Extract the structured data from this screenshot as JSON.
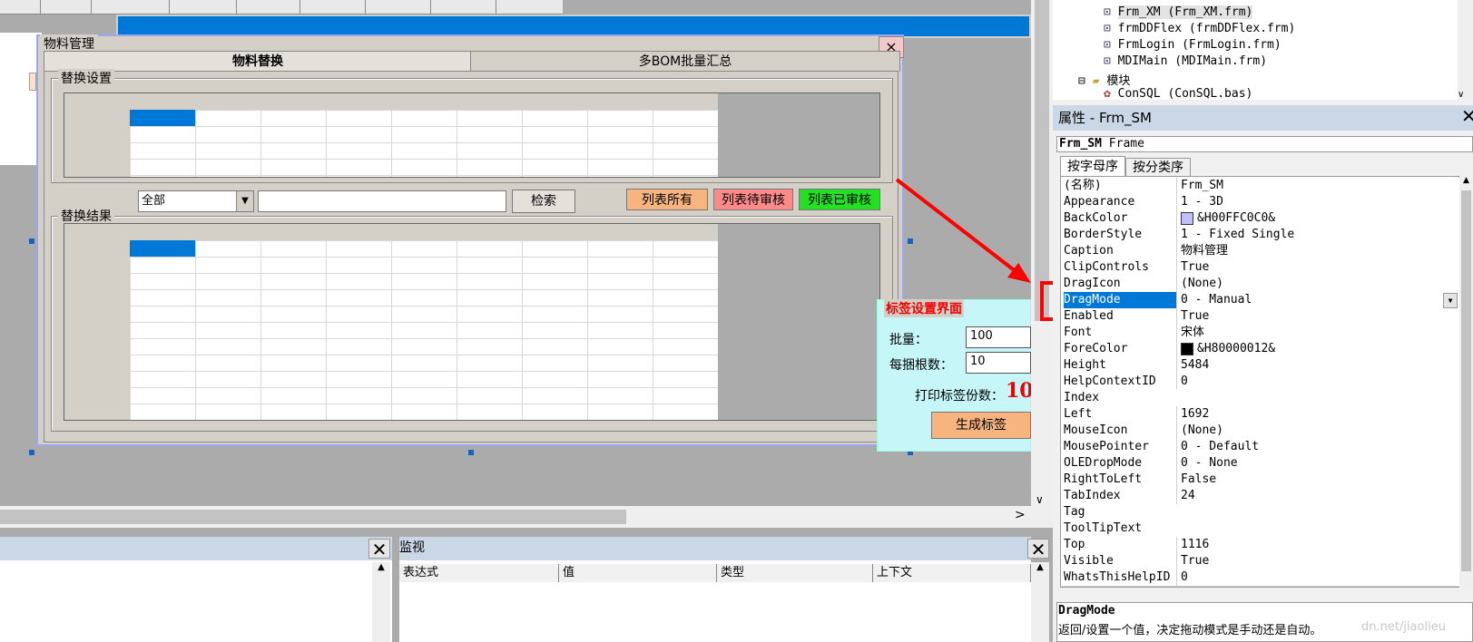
{
  "form": {
    "caption": "物料管理",
    "close": "×",
    "tabs": [
      {
        "label": "物料替换"
      },
      {
        "label": "多BOM批量汇总"
      }
    ],
    "frame_settings": "替换设置",
    "frame_results": "替换结果",
    "filter_value": "全部",
    "search_label": "检索",
    "btn_all": "列表所有",
    "btn_pending": "列表待审核",
    "btn_approved": "列表已审核"
  },
  "label_dialog": {
    "title": "标签设置界面",
    "qty_label": "批量：",
    "qty_value": "100",
    "per_bundle_label": "每捆根数：",
    "per_bundle_value": "10",
    "copies_label": "打印标签份数：",
    "copies_value": "10",
    "generate_label": "生成标签"
  },
  "watch": {
    "title": "监视",
    "columns": [
      "表达式",
      "值",
      "类型",
      "上下文"
    ]
  },
  "project_tree": {
    "items": [
      {
        "text": "Frm_XM (Frm_XM.frm)"
      },
      {
        "text": "frmDDFlex (frmDDFlex.frm)"
      },
      {
        "text": "FrmLogin (FrmLogin.frm)"
      },
      {
        "text": "MDIMain (MDIMain.frm)"
      }
    ],
    "folder_modules": "模块",
    "module_item": "ConSQL (ConSQL.bas)"
  },
  "properties": {
    "title": "属性 - Frm_SM",
    "object_name": "Frm_SM",
    "object_type": "Frame",
    "tab_alpha": "按字母序",
    "tab_category": "按分类序",
    "rows": [
      {
        "name": "(名称)",
        "value": "Frm_SM"
      },
      {
        "name": "Appearance",
        "value": "1 - 3D"
      },
      {
        "name": "BackColor",
        "value": "&H00FFC0C0&"
      },
      {
        "name": "BorderStyle",
        "value": "1 - Fixed Single"
      },
      {
        "name": "Caption",
        "value": "物料管理"
      },
      {
        "name": "ClipControls",
        "value": "True"
      },
      {
        "name": "DragIcon",
        "value": "(None)"
      },
      {
        "name": "DragMode",
        "value": "0 - Manual"
      },
      {
        "name": "Enabled",
        "value": "True"
      },
      {
        "name": "Font",
        "value": "宋体"
      },
      {
        "name": "ForeColor",
        "value": "&H80000012&"
      },
      {
        "name": "Height",
        "value": "5484"
      },
      {
        "name": "HelpContextID",
        "value": "0"
      },
      {
        "name": "Index",
        "value": ""
      },
      {
        "name": "Left",
        "value": "1692"
      },
      {
        "name": "MouseIcon",
        "value": "(None)"
      },
      {
        "name": "MousePointer",
        "value": "0 - Default"
      },
      {
        "name": "OLEDropMode",
        "value": "0 - None"
      },
      {
        "name": "RightToLeft",
        "value": "False"
      },
      {
        "name": "TabIndex",
        "value": "24"
      },
      {
        "name": "Tag",
        "value": ""
      },
      {
        "name": "ToolTipText",
        "value": ""
      },
      {
        "name": "Top",
        "value": "1116"
      },
      {
        "name": "Visible",
        "value": "True"
      },
      {
        "name": "WhatsThisHelpID",
        "value": "0"
      }
    ],
    "desc_title": "DragMode",
    "desc_text": "返回/设置一个值，决定拖动模式是手动还是自动。",
    "watermark": "dn.net/jiaolieu"
  },
  "colors": {
    "backcolor_swatch": "#c0c0ff",
    "forecolor_swatch": "#000000",
    "highlight": "#0078d7",
    "annotation": "#ff0000"
  }
}
